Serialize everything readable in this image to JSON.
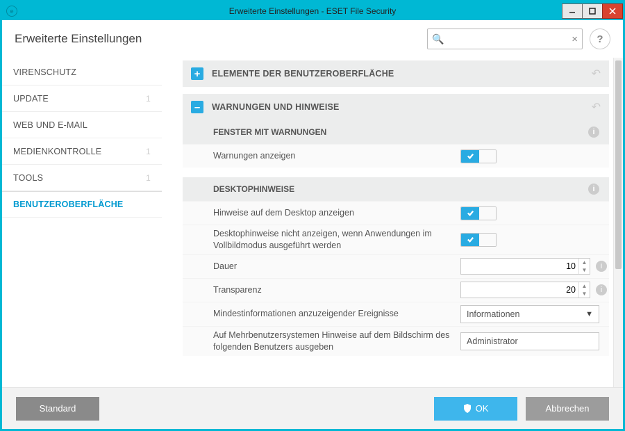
{
  "window": {
    "title": "Erweiterte Einstellungen - ESET File Security"
  },
  "header": {
    "title": "Erweiterte Einstellungen",
    "search_placeholder": ""
  },
  "sidebar": {
    "items": [
      {
        "label": "VIRENSCHUTZ",
        "count": ""
      },
      {
        "label": "UPDATE",
        "count": "1"
      },
      {
        "label": "WEB UND E-MAIL",
        "count": ""
      },
      {
        "label": "MEDIENKONTROLLE",
        "count": "1"
      },
      {
        "label": "TOOLS",
        "count": "1"
      },
      {
        "label": "BENUTZEROBERFLÄCHE",
        "count": ""
      }
    ]
  },
  "sections": {
    "ui_elements": {
      "title": "ELEMENTE DER BENUTZEROBERFLÄCHE"
    },
    "alerts": {
      "title": "WARNUNGEN UND HINWEISE",
      "group_windows": {
        "title": "FENSTER MIT WARNUNGEN"
      },
      "show_warnings": {
        "label": "Warnungen anzeigen",
        "value": true
      },
      "group_desktop": {
        "title": "DESKTOPHINWEISE"
      },
      "show_desktop": {
        "label": "Hinweise auf dem Desktop anzeigen",
        "value": true
      },
      "hide_fullscreen": {
        "label": "Desktophinweise nicht anzeigen, wenn Anwendungen im Vollbildmodus ausgeführt werden",
        "value": true
      },
      "duration": {
        "label": "Dauer",
        "value": "10"
      },
      "transparency": {
        "label": "Transparenz",
        "value": "20"
      },
      "min_events": {
        "label": "Mindestinformationen anzuzeigender Ereignisse",
        "value": "Informationen"
      },
      "multiuser": {
        "label": "Auf Mehrbenutzersystemen Hinweise auf dem Bildschirm des folgenden Benutzers ausgeben",
        "value": "Administrator"
      }
    }
  },
  "footer": {
    "default": "Standard",
    "ok": "OK",
    "cancel": "Abbrechen"
  }
}
